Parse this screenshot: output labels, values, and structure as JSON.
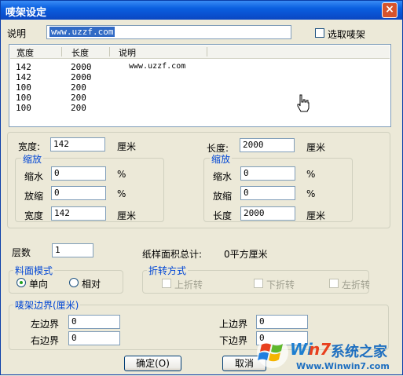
{
  "window": {
    "title": "唛架设定",
    "close_glyph": "×"
  },
  "desc": {
    "label": "说明",
    "value": "www.uzzf.com",
    "select_checkbox_label": "选取唛架",
    "select_checked": false
  },
  "list": {
    "columns": [
      "宽度",
      "长度",
      "说明"
    ],
    "rows": [
      {
        "width": "142",
        "length": "2000",
        "note": "www.uzzf.com"
      },
      {
        "width": "142",
        "length": "2000",
        "note": ""
      },
      {
        "width": "100",
        "length": "200",
        "note": ""
      },
      {
        "width": "100",
        "length": "200",
        "note": ""
      },
      {
        "width": "100",
        "length": "200",
        "note": ""
      }
    ]
  },
  "left": {
    "width_label": "宽度:",
    "width_value": "142",
    "width_unit": "厘米",
    "group_title": "缩放",
    "shrink_label": "缩水",
    "shrink_value": "0",
    "shrink_unit": "%",
    "scale_label": "放缩",
    "scale_value": "0",
    "scale_unit": "%",
    "result_label": "宽度",
    "result_value": "142",
    "result_unit": "厘米"
  },
  "right": {
    "length_label": "长度:",
    "length_value": "2000",
    "length_unit": "厘米",
    "group_title": "缩放",
    "shrink_label": "缩水",
    "shrink_value": "0",
    "shrink_unit": "%",
    "scale_label": "放缩",
    "scale_value": "0",
    "scale_unit": "%",
    "result_label": "长度",
    "result_value": "2000",
    "result_unit": "厘米"
  },
  "layers": {
    "label": "层数",
    "value": "1"
  },
  "area": {
    "label": "纸样面积总计:",
    "value": "0平方厘米"
  },
  "fabric_mode": {
    "title": "料面模式",
    "option_one": "单向",
    "option_two": "相对",
    "selected": "单向"
  },
  "fold": {
    "title": "折转方式",
    "up": "上折转",
    "down": "下折转",
    "left": "左折转"
  },
  "margins": {
    "title": "唛架边界(厘米)",
    "left_label": "左边界",
    "left_value": "0",
    "right_label": "右边界",
    "right_value": "0",
    "top_label": "上边界",
    "top_value": "0",
    "bottom_label": "下边界",
    "bottom_value": "0"
  },
  "buttons": {
    "ok": "确定(O)",
    "cancel": "取消"
  },
  "watermark": {
    "brand_a": "Wi",
    "brand_b": "n7",
    "brand_c": "系统之家",
    "url": "Www.Winwin7.com"
  },
  "colors": {
    "accent_blue": "#0046d5",
    "title_bar": "#0a52d2",
    "radio_dot": "#21a121"
  }
}
